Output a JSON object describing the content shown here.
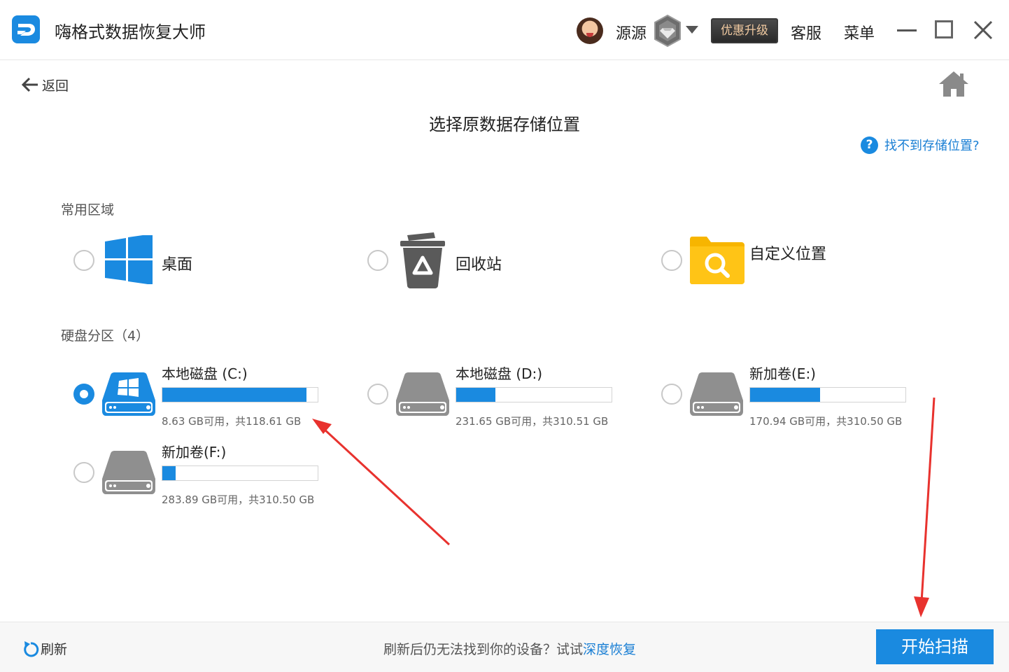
{
  "window": {
    "title": "嗨格式数据恢复大师",
    "username": "源源",
    "upgrade_label": "优惠升级",
    "service_label": "客服",
    "menu_label": "菜单"
  },
  "nav": {
    "back_label": "返回"
  },
  "page": {
    "title": "选择原数据存储位置",
    "help_link": "找不到存储位置?"
  },
  "common_section": {
    "label": "常用区域",
    "items": [
      {
        "label": "桌面",
        "icon": "windows-icon",
        "selected": false
      },
      {
        "label": "回收站",
        "icon": "recycle-bin-icon",
        "selected": false
      },
      {
        "label": "自定义位置",
        "icon": "folder-search-icon",
        "selected": false
      }
    ]
  },
  "disk_section": {
    "label": "硬盘分区（4）",
    "drives": [
      {
        "name": "本地磁盘 (C:)",
        "space": "8.63 GB可用，共118.61 GB",
        "used_fraction": 0.927,
        "selected": true,
        "system": true
      },
      {
        "name": "本地磁盘 (D:)",
        "space": "231.65 GB可用，共310.51 GB",
        "used_fraction": 0.254,
        "selected": false,
        "system": false
      },
      {
        "name": "新加卷(E:)",
        "space": "170.94 GB可用，共310.50 GB",
        "used_fraction": 0.449,
        "selected": false,
        "system": false
      },
      {
        "name": "新加卷(F:)",
        "space": "283.89 GB可用，共310.50 GB",
        "used_fraction": 0.086,
        "selected": false,
        "system": false
      }
    ]
  },
  "footer": {
    "refresh_label": "刷新",
    "hint_text": "刷新后仍无法找到你的设备？试试",
    "deep_recover_label": "深度恢复",
    "start_scan_label": "开始扫描"
  },
  "colors": {
    "accent": "#1a8ae0",
    "annotation": "#e8322e",
    "folder": "#f7b500"
  }
}
